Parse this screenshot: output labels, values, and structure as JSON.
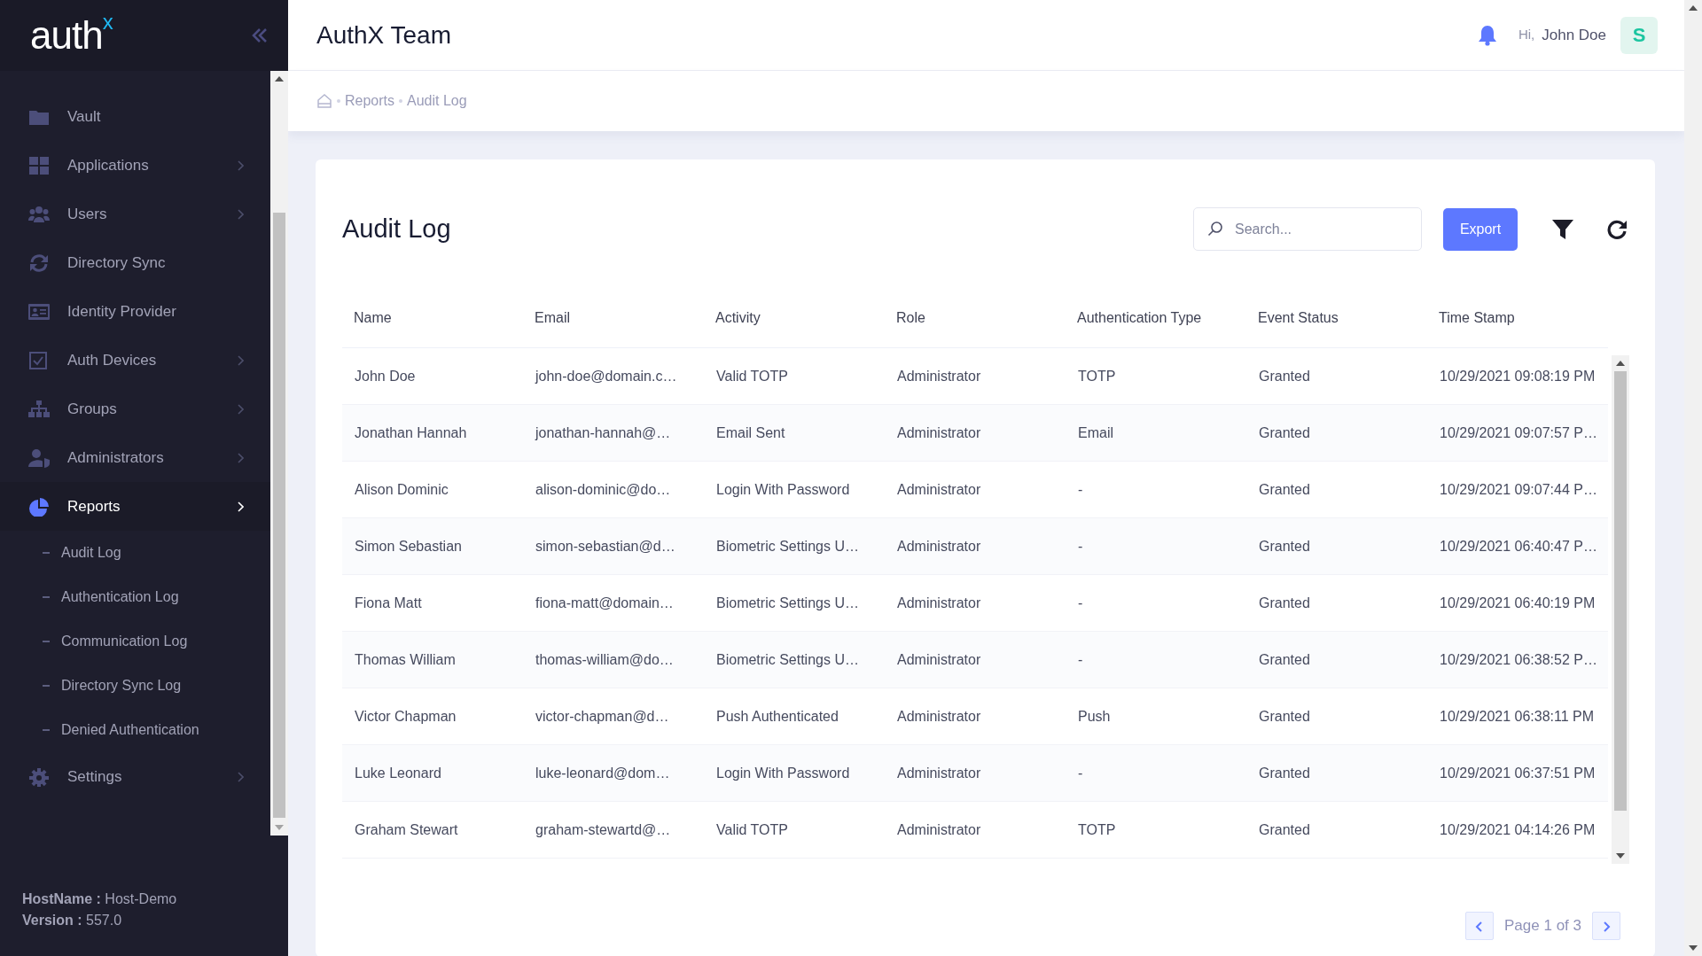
{
  "sidebar": {
    "logo": "auth$^{x}$",
    "items": [
      {
        "label": "Vault",
        "has_submenu": false,
        "selected": false
      },
      {
        "label": "Applications",
        "has_submenu": true,
        "selected": false
      },
      {
        "label": "Users",
        "has_submenu": true,
        "selected": false
      },
      {
        "label": "Directory Sync",
        "has_submenu": false,
        "selected": false
      },
      {
        "label": "Identity Provider",
        "has_submenu": false,
        "selected": false
      },
      {
        "label": "Auth Devices",
        "has_submenu": true,
        "selected": false
      },
      {
        "label": "Groups",
        "has_submenu": true,
        "selected": false
      },
      {
        "label": "Administrators",
        "has_submenu": true,
        "selected": false
      },
      {
        "label": "Reports",
        "has_submenu": true,
        "selected": true,
        "expanded": true,
        "children": [
          {
            "label": "Audit Log",
            "selected": false
          },
          {
            "label": "Authentication Log",
            "selected": false
          },
          {
            "label": "Communication Log",
            "selected": false
          },
          {
            "label": "Directory Sync Log",
            "selected": false
          },
          {
            "label": "Denied Authentication",
            "selected": false
          }
        ]
      },
      {
        "label": "Settings",
        "has_submenu": true,
        "selected": false
      }
    ],
    "footer": [
      "**HostName :** Host-Demo",
      "**Version :** 557.0"
    ]
  },
  "header": {
    "title": "AuthX Team",
    "greeting": "Hi,",
    "user": "John Doe",
    "avatar": "S"
  },
  "breadcrumb": [
    "Reports",
    "Audit Log"
  ],
  "card": {
    "title": "Audit Log",
    "search": {
      "placeholder": "Search..."
    },
    "export": "Export",
    "table": {
      "columns": [
        "Name",
        "Email",
        "Activity",
        "Role",
        "Authentication Type",
        "Event Status",
        "Time Stamp"
      ],
      "rows": [
        [
          "John Doe",
          "john-doe@domain.c…",
          "Valid TOTP",
          "Administrator",
          "TOTP",
          "Granted",
          "10/29/2021 09:08:19 PM"
        ],
        [
          "Jonathan Hannah",
          "jonathan-hannah@…",
          "Email Sent",
          "Administrator",
          "Email",
          "Granted",
          "10/29/2021 09:07:57 P…"
        ],
        [
          "Alison Dominic",
          "alison-dominic@do…",
          "Login With Password",
          "Administrator",
          "-",
          "Granted",
          "10/29/2021 09:07:44 P…"
        ],
        [
          "Simon Sebastian",
          "simon-sebastian@d…",
          "Biometric Settings U…",
          "Administrator",
          "-",
          "Granted",
          "10/29/2021 06:40:47 P…"
        ],
        [
          "Fiona Matt",
          "fiona-matt@domain…",
          "Biometric Settings U…",
          "Administrator",
          "-",
          "Granted",
          "10/29/2021 06:40:19 PM"
        ],
        [
          "Thomas William",
          "thomas-william@do…",
          "Biometric Settings U…",
          "Administrator",
          "-",
          "Granted",
          "10/29/2021 06:38:52 P…"
        ],
        [
          "Victor Chapman",
          "victor-chapman@d…",
          "Push Authenticated",
          "Administrator",
          "Push",
          "Granted",
          "10/29/2021 06:38:11 PM"
        ],
        [
          "Luke Leonard",
          "luke-leonard@dom…",
          "Login With Password",
          "Administrator",
          "-",
          "Granted",
          "10/29/2021 06:37:51 PM"
        ],
        [
          "Graham Stewart",
          "graham-stewartd@…",
          "Valid TOTP",
          "Administrator",
          "TOTP",
          "Granted",
          "10/29/2021 04:14:26 PM"
        ]
      ]
    },
    "pagination": "Page 1 of 3"
  }
}
